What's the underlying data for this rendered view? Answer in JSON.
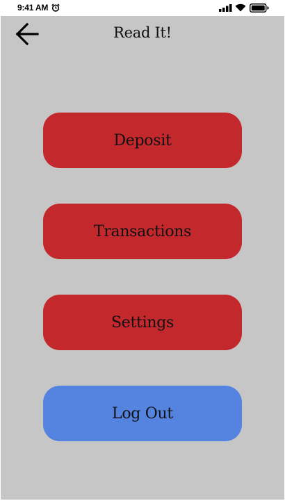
{
  "status_bar": {
    "time": "9:41 AM",
    "icons": [
      "alarm-icon",
      "signal-icon",
      "wifi-icon",
      "battery-icon"
    ]
  },
  "header": {
    "back_icon": "arrow-left-icon",
    "title": "Read It!"
  },
  "menu": {
    "deposit_label": "Deposit",
    "transactions_label": "Transactions",
    "settings_label": "Settings",
    "logout_label": "Log Out"
  },
  "colors": {
    "background": "#c6c6c6",
    "primary_button": "#c3292c",
    "logout_button": "#5484e0",
    "text": "#111111"
  }
}
